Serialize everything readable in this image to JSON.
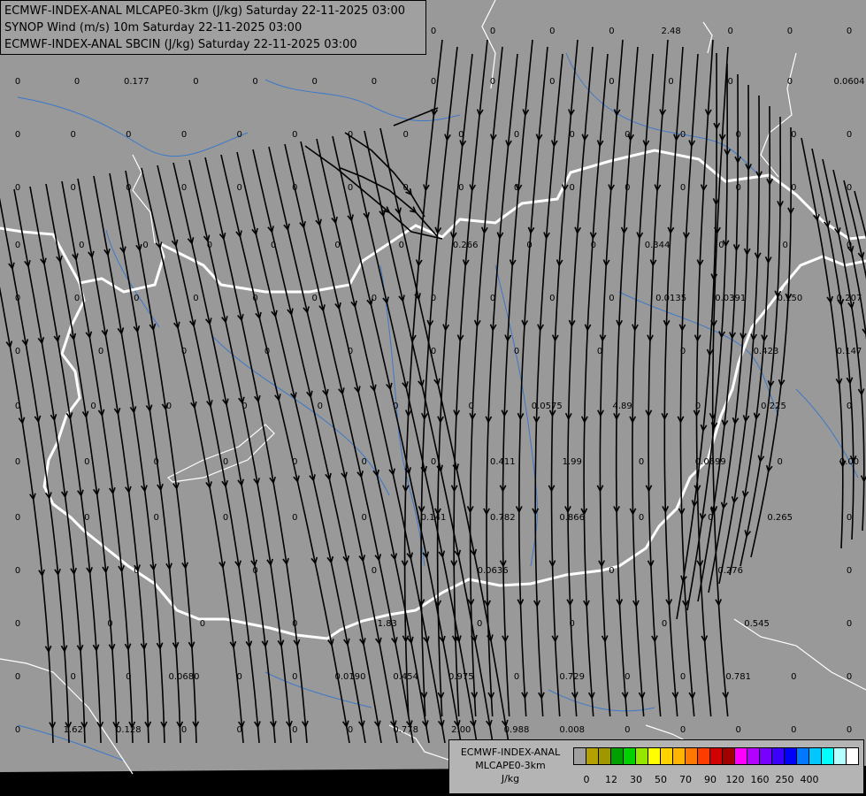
{
  "header": {
    "line1": "ECMWF-INDEX-ANAL MLCAPE0-3km (J/kg) Saturday 22-11-2025 03:00",
    "line2": "SYNOP Wind (m/s) 10m Saturday 22-11-2025 03:00",
    "line3": "ECMWF-INDEX-ANAL SBCIN (J/kg) Saturday 22-11-2025 03:00"
  },
  "legend": {
    "title1": "ECMWF-INDEX-ANAL",
    "title2": "MLCAPE0-3km",
    "unit": "J/kg",
    "colors": [
      "#a0a0a0",
      "#b4a000",
      "#a09600",
      "#00a000",
      "#00d200",
      "#96e600",
      "#ffff00",
      "#ffd200",
      "#ffb400",
      "#ff7800",
      "#ff3c00",
      "#d20000",
      "#a00000",
      "#ff00ff",
      "#b400ff",
      "#7800ff",
      "#3c00ff",
      "#0000ff",
      "#0078ff",
      "#00c8ff",
      "#00ffff",
      "#b4ffff",
      "#ffffff"
    ],
    "ticks": [
      "0",
      "12",
      "30",
      "50",
      "70",
      "90",
      "120",
      "160",
      "250",
      "400"
    ]
  },
  "colors": {
    "background": "#999999",
    "border": "#ffffff",
    "river": "#3c78c8",
    "streamline": "#000000",
    "lower_band": "#000000"
  },
  "values": [
    "0",
    "0",
    "0",
    "0",
    "0",
    "0",
    "0",
    "0",
    "0",
    "0",
    "0",
    "2.48",
    "0",
    "0",
    "0",
    "0",
    "0",
    "0.177",
    "0",
    "0",
    "0",
    "0",
    "0",
    "0",
    "0",
    "0",
    "0",
    "0",
    "0",
    "0.0604",
    "0",
    "0",
    "0",
    "0",
    "0",
    "0",
    "0",
    "0",
    "0",
    "0",
    "0",
    "0",
    "0",
    "0",
    "0",
    "0",
    "0",
    "0",
    "0",
    "0",
    "0",
    "0",
    "0",
    "0",
    "0",
    "0",
    "0",
    "0",
    "0",
    "0",
    "0",
    "0",
    "0",
    "0",
    "0",
    "0",
    "0",
    "0",
    "0",
    "0.266",
    "0",
    "0",
    "0.344",
    "0",
    "0",
    "0",
    "0",
    "0",
    "0",
    "0",
    "0",
    "0",
    "0",
    "0",
    "0",
    "0",
    "0",
    "0.0135",
    "0.0391",
    "0.150",
    "0.207",
    "0",
    "0",
    "0",
    "0",
    "0",
    "0",
    "0",
    "0",
    "0",
    "0.423",
    "0.147",
    "0",
    "0",
    "0",
    "0",
    "0",
    "0",
    "0",
    "0.0575",
    "4.89",
    "0",
    "0.225",
    "0",
    "0",
    "0",
    "0",
    "0",
    "0",
    "0",
    "0",
    "0.411",
    "1.99",
    "0",
    "0.0699",
    "0",
    "0.00",
    "0",
    "0",
    "0",
    "0",
    "0",
    "0",
    "0.141",
    "0.782",
    "0.866",
    "0",
    "0",
    "0.265",
    "0",
    "0",
    "0",
    "0",
    "0",
    "0.0636",
    "0",
    "0.276",
    "0",
    "0",
    "0",
    "0",
    "0",
    "1.83",
    "0",
    "0",
    "0",
    "0.545",
    "0",
    "0",
    "0",
    "0",
    "0.0680",
    "0",
    "0",
    "0.0190",
    "0.454",
    "0.975",
    "0",
    "0.729",
    "0",
    "0",
    "0.781",
    "0",
    "0",
    "0",
    "1.62",
    "0.128",
    "0",
    "0",
    "0",
    "0",
    "0.778",
    "2.00",
    "0.988",
    "0.008",
    "0",
    "0",
    "0",
    "0",
    "0"
  ]
}
